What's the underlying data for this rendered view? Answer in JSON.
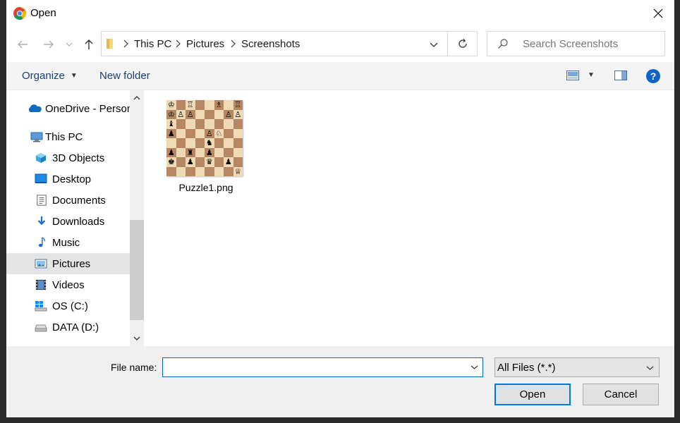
{
  "window": {
    "title": "Open"
  },
  "address": {
    "crumbs": [
      "This PC",
      "Pictures",
      "Screenshots"
    ]
  },
  "search": {
    "placeholder": "Search Screenshots"
  },
  "toolbar": {
    "organize_label": "Organize",
    "new_folder_label": "New folder",
    "help_label": "?"
  },
  "sidebar": {
    "items": [
      {
        "label": "OneDrive - Person",
        "icon": "onedrive-icon"
      },
      {
        "label": "This PC",
        "icon": "computer-icon"
      },
      {
        "label": "3D Objects",
        "icon": "cube-icon"
      },
      {
        "label": "Desktop",
        "icon": "desktop-icon"
      },
      {
        "label": "Documents",
        "icon": "document-icon"
      },
      {
        "label": "Downloads",
        "icon": "download-icon"
      },
      {
        "label": "Music",
        "icon": "music-icon"
      },
      {
        "label": "Pictures",
        "icon": "pictures-icon",
        "selected": true
      },
      {
        "label": "Videos",
        "icon": "video-icon"
      },
      {
        "label": "OS (C:)",
        "icon": "windows-drive-icon"
      },
      {
        "label": "DATA (D:)",
        "icon": "drive-icon"
      }
    ]
  },
  "files": [
    {
      "name": "Puzzle1.png",
      "type": "image"
    }
  ],
  "bottom": {
    "file_name_label": "File name:",
    "file_name_value": "",
    "filter_value": "All Files (*.*)",
    "open_label": "Open",
    "cancel_label": "Cancel"
  },
  "colors": {
    "accent": "#0078d7",
    "selected_bg": "#e5e5e5",
    "toolbar_bg": "#f3f3f3",
    "link": "#1a3f6d"
  }
}
